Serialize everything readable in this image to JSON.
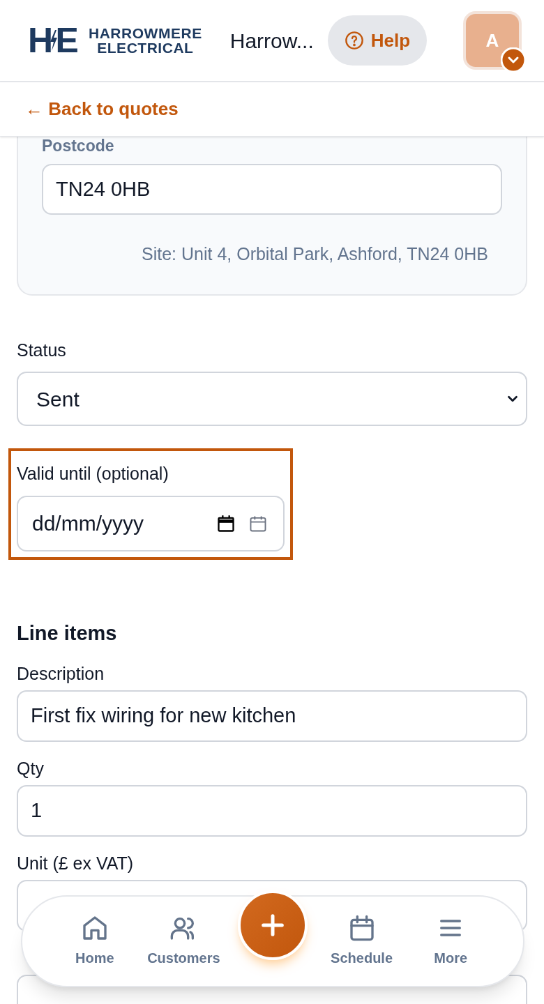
{
  "header": {
    "logo": {
      "mark_left": "H",
      "mark_right": "E",
      "name_line1": "HARROWMERE",
      "name_line2": "ELECTRICAL"
    },
    "title": "Harrow...",
    "help_button": "Help",
    "avatar": {
      "initial": "A"
    }
  },
  "back_link": "← Back to quotes",
  "site_card": {
    "postcode_label": "Postcode",
    "postcode_value": "TN24 0HB",
    "site_text": "Site: Unit 4, Orbital Park, Ashford, TN24 0HB"
  },
  "status": {
    "label": "Status",
    "value": "Sent"
  },
  "valid_until": {
    "label": "Valid until (optional)",
    "placeholder": "dd/mm/yyyy",
    "highlighted": true
  },
  "line_items": {
    "heading": "Line items",
    "fields": [
      {
        "kind": "text",
        "label": "Description",
        "value": "First fix wiring for new kitchen"
      },
      {
        "kind": "text",
        "label": "Qty",
        "value": "1"
      },
      {
        "kind": "text",
        "label": "Unit (£ ex VAT)"
      },
      {
        "kind": "select"
      }
    ]
  },
  "bottom_nav": {
    "items": [
      {
        "kind": "home",
        "label": "Home"
      },
      {
        "kind": "customers",
        "label": "Customers"
      },
      {
        "kind": "add"
      },
      {
        "kind": "schedule",
        "label": "Schedule"
      },
      {
        "kind": "more",
        "label": "More"
      }
    ]
  }
}
